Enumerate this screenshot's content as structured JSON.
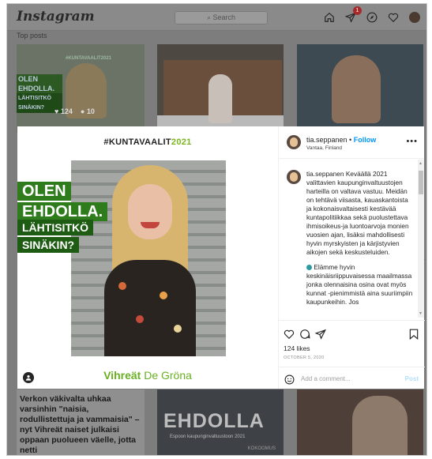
{
  "app": {
    "logo": "Instagram"
  },
  "nav": {
    "search_placeholder": "Search",
    "notification_count": "1",
    "icons": [
      "home-icon",
      "direct-icon",
      "explore-icon",
      "heart-icon",
      "avatar"
    ]
  },
  "grid": {
    "section_label": "Top posts",
    "tile1": {
      "lines": [
        "#KUNTAVAALIT2021",
        "OLEN",
        "EHDOLLA.",
        "LÄHTISITKÖ",
        "SINÄKIN?"
      ],
      "likes": "124",
      "comments": "10"
    },
    "tile4": {
      "text": "Verkon väkivalta uhkaa varsinhin \"naisia, rodullistettuja ja vammaisia\" – nyt Vihreät naiset julkaisi oppaan puolueen väelle, jotta netti"
    },
    "tile5": {
      "big": "EHDOLLA",
      "sub": "Espoon kaupunginvaltuustoon 2021",
      "brand": "KOKOOMUS"
    }
  },
  "post": {
    "hashtag": "#KUNTAVAALIT",
    "hashtag_year": "2021",
    "banner_lines": [
      "OLEN",
      "EHDOLLA.",
      "LÄHTISITKÖ",
      "SINÄKIN?"
    ],
    "footer_bold": "Vihreät",
    "footer_light": "De Gröna",
    "username": "tia.seppanen",
    "separator": " • ",
    "follow_label": "Follow",
    "location": "Vantaa, Finland",
    "more": "•••",
    "caption_user": "tia.seppanen",
    "caption_p1": "Keväällä 2021 valittavien kaupunginvaltuustojen harteilla on valtava vastuu. Meidän on tehtävä viisasta, kauaskantoista ja kokonaisvaltaisesti kestävää kuntapolitiikkaa sekä puolustettava ihmisoikeus-ja luontoarvoja monien vuosien ajan, lisäksi mahdollisesti hyvin myrskyisten ja kärjistyvien aikojen sekä keskusteluiden.",
    "caption_p2": "Elämme hyvin keskinäisriippuvaisessa maailmassa jonka olennaisina osina ovat myös kunnat -pienimmistä aina suuriimpiin kaupunkeihin. Jos",
    "likes": "124 likes",
    "date": "OCTOBER 5, 2020",
    "comment_placeholder": "Add a comment...",
    "post_label": "Post"
  }
}
